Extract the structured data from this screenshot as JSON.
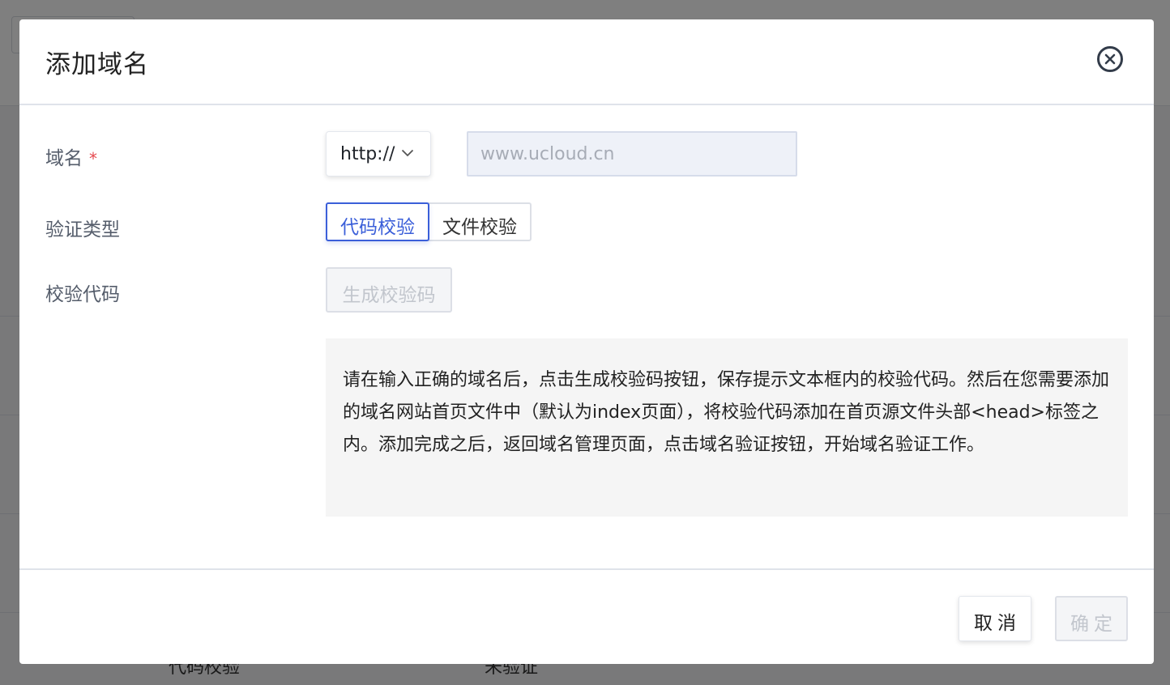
{
  "background": {
    "row_items": [
      "代码校验",
      "未验证"
    ]
  },
  "modal": {
    "title": "添加域名",
    "close_icon": "close-circle-icon"
  },
  "form": {
    "domain_label": "域名",
    "required_mark": "*",
    "protocol_selected": "http://",
    "domain_input_value": "",
    "domain_input_placeholder": "www.ucloud.cn",
    "verify_type_label": "验证类型",
    "verify_type_options": [
      "代码校验",
      "文件校验"
    ],
    "verify_type_selected": "代码校验",
    "verify_code_label": "校验代码",
    "generate_button": "生成校验码",
    "tip_text": "请在输入正确的域名后，点击生成校验码按钮，保存提示文本框内的校验代码。然后在您需要添加的域名网站首页文件中（默认为index页面），将校验代码添加在首页源文件头部<head>标签之内。添加完成之后，返回域名管理页面，点击域名验证按钮，开始域名验证工作。"
  },
  "footer": {
    "cancel_label": "取消",
    "confirm_label": "确定"
  },
  "colors": {
    "accent": "#3b5fd9",
    "required": "#e5484d",
    "tip_background": "#f5f5f5"
  }
}
